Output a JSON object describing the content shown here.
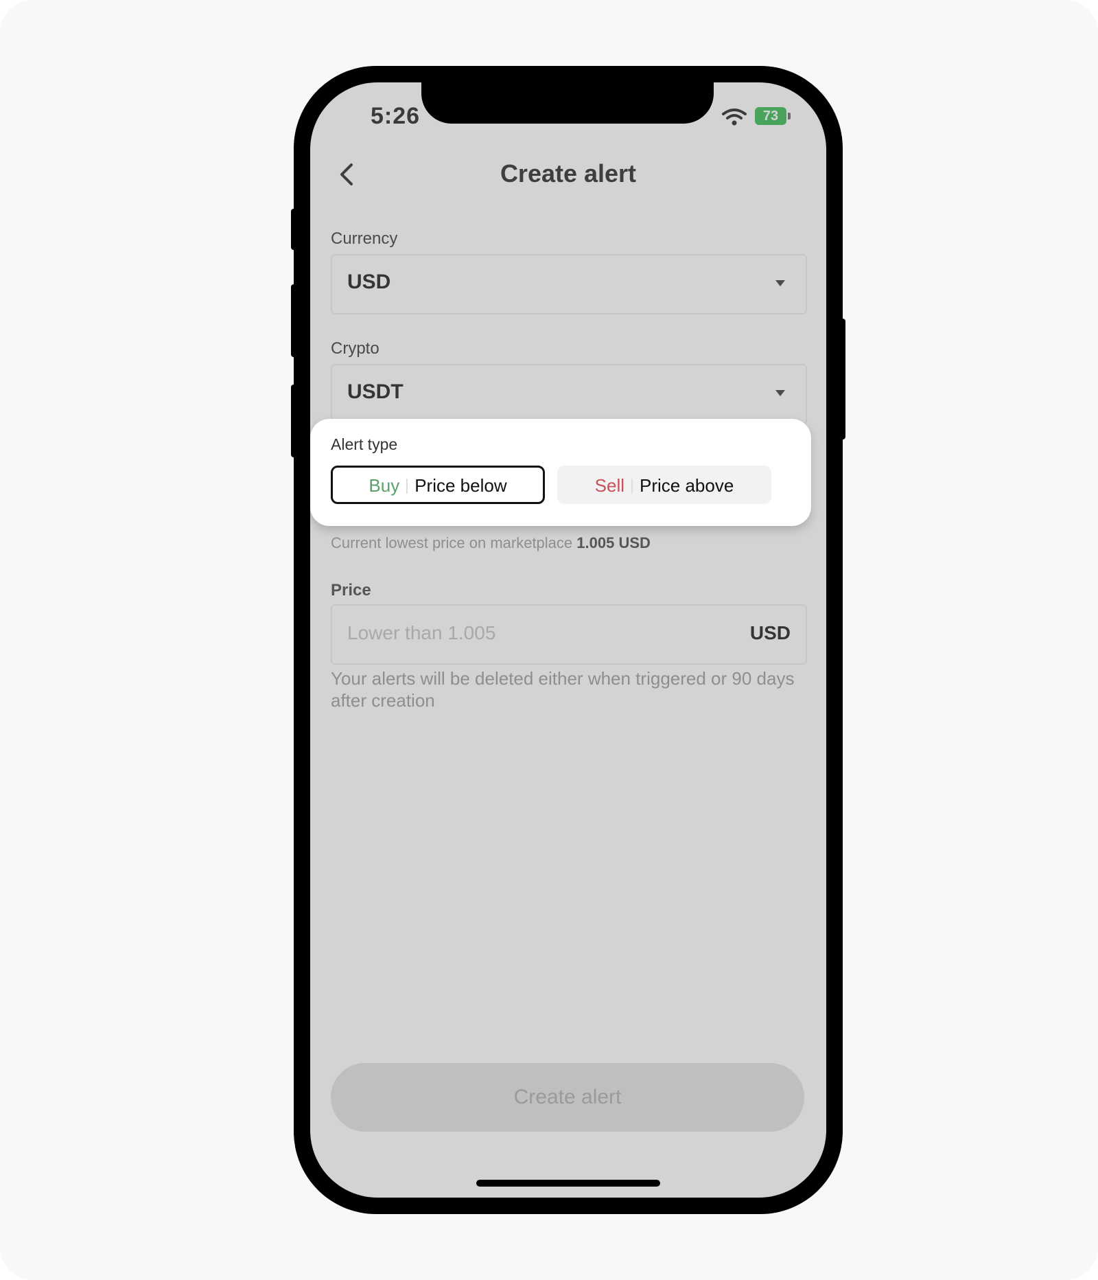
{
  "status_bar": {
    "time": "5:26",
    "battery": "73"
  },
  "header": {
    "title": "Create alert"
  },
  "currency": {
    "label": "Currency",
    "value": "USD"
  },
  "crypto": {
    "label": "Crypto",
    "value": "USDT"
  },
  "alert_type": {
    "label": "Alert type",
    "buy": {
      "side": "Buy",
      "text": "Price below"
    },
    "sell": {
      "side": "Sell",
      "text": "Price above"
    }
  },
  "market_info": {
    "text": "Current lowest price on marketplace",
    "value": "1.005 USD"
  },
  "price": {
    "label": "Price",
    "placeholder": "Lower than 1.005",
    "unit": "USD"
  },
  "hint": "Your alerts will be deleted either when triggered or 90 days after creation",
  "submit_label": "Create alert",
  "colors": {
    "buy": "#5aa06a",
    "sell": "#c8505a",
    "battery": "#4aa35a"
  }
}
